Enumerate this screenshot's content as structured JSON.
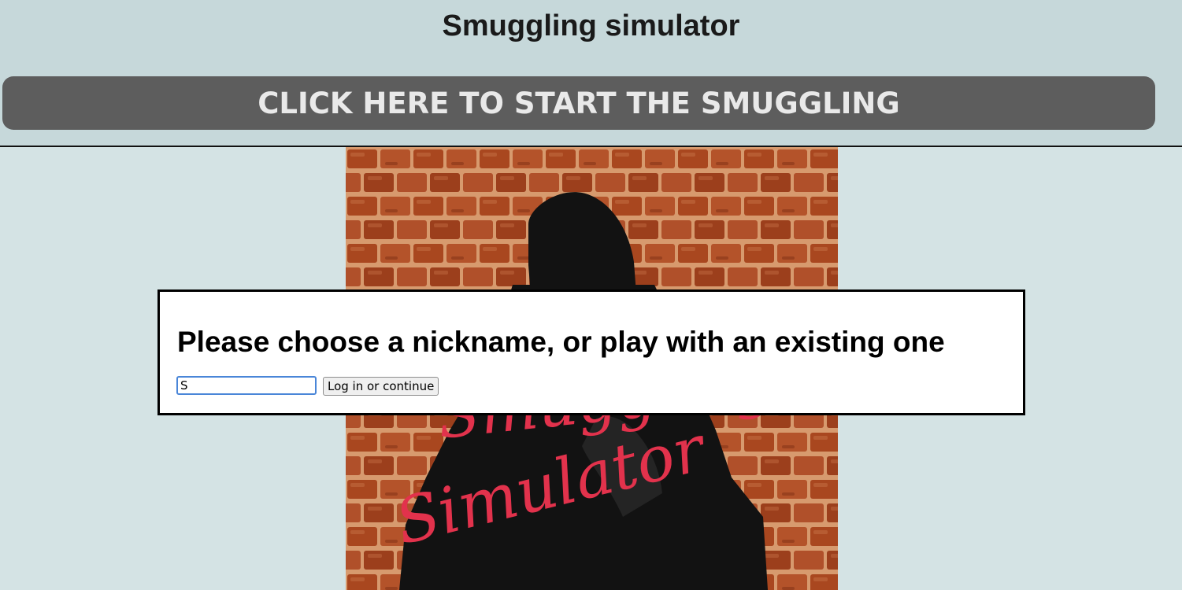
{
  "header": {
    "title": "Smuggling simulator",
    "start_button_label": "CLICK HERE TO START THE SMUGGLING"
  },
  "poster": {
    "title_line_1": "Smuggling",
    "title_line_2": "Simulator",
    "colors": {
      "brick": "#a9471f",
      "mortar": "#d79a6e",
      "text": "#e2324c"
    }
  },
  "dialog": {
    "heading": "Please choose a nickname, or play with an existing one",
    "nickname_value": "S",
    "submit_label": "Log in or continue"
  },
  "colors": {
    "page_bg": "#d4e3e4",
    "header_bg": "#c6d8da",
    "button_bg": "#5d5d5d"
  }
}
